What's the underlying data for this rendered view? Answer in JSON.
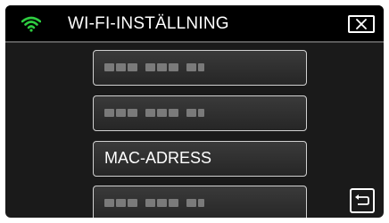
{
  "header": {
    "title": "WI-FI-INSTÄLLNING",
    "wifi_icon": "wifi-icon",
    "close_icon": "close-icon",
    "accent_color": "#2ecc40"
  },
  "items": [
    {
      "label": "",
      "masked": true
    },
    {
      "label": "",
      "masked": true
    },
    {
      "label": "MAC-ADRESS",
      "masked": false
    },
    {
      "label": "",
      "masked": true
    }
  ],
  "footer": {
    "back_icon": "back-arrow-icon"
  }
}
